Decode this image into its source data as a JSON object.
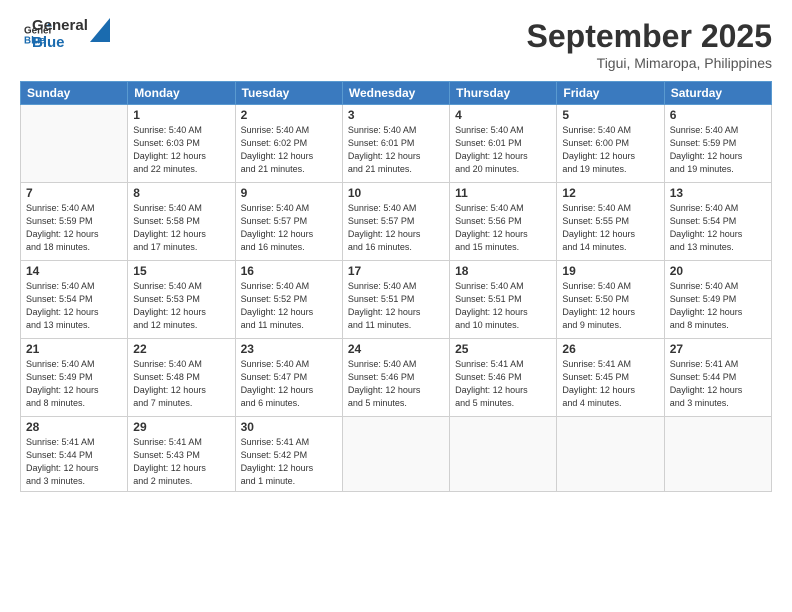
{
  "header": {
    "logo_general": "General",
    "logo_blue": "Blue",
    "month_title": "September 2025",
    "subtitle": "Tigui, Mimaropa, Philippines"
  },
  "weekdays": [
    "Sunday",
    "Monday",
    "Tuesday",
    "Wednesday",
    "Thursday",
    "Friday",
    "Saturday"
  ],
  "weeks": [
    [
      {
        "day": "",
        "info": ""
      },
      {
        "day": "1",
        "info": "Sunrise: 5:40 AM\nSunset: 6:03 PM\nDaylight: 12 hours\nand 22 minutes."
      },
      {
        "day": "2",
        "info": "Sunrise: 5:40 AM\nSunset: 6:02 PM\nDaylight: 12 hours\nand 21 minutes."
      },
      {
        "day": "3",
        "info": "Sunrise: 5:40 AM\nSunset: 6:01 PM\nDaylight: 12 hours\nand 21 minutes."
      },
      {
        "day": "4",
        "info": "Sunrise: 5:40 AM\nSunset: 6:01 PM\nDaylight: 12 hours\nand 20 minutes."
      },
      {
        "day": "5",
        "info": "Sunrise: 5:40 AM\nSunset: 6:00 PM\nDaylight: 12 hours\nand 19 minutes."
      },
      {
        "day": "6",
        "info": "Sunrise: 5:40 AM\nSunset: 5:59 PM\nDaylight: 12 hours\nand 19 minutes."
      }
    ],
    [
      {
        "day": "7",
        "info": "Sunrise: 5:40 AM\nSunset: 5:59 PM\nDaylight: 12 hours\nand 18 minutes."
      },
      {
        "day": "8",
        "info": "Sunrise: 5:40 AM\nSunset: 5:58 PM\nDaylight: 12 hours\nand 17 minutes."
      },
      {
        "day": "9",
        "info": "Sunrise: 5:40 AM\nSunset: 5:57 PM\nDaylight: 12 hours\nand 16 minutes."
      },
      {
        "day": "10",
        "info": "Sunrise: 5:40 AM\nSunset: 5:57 PM\nDaylight: 12 hours\nand 16 minutes."
      },
      {
        "day": "11",
        "info": "Sunrise: 5:40 AM\nSunset: 5:56 PM\nDaylight: 12 hours\nand 15 minutes."
      },
      {
        "day": "12",
        "info": "Sunrise: 5:40 AM\nSunset: 5:55 PM\nDaylight: 12 hours\nand 14 minutes."
      },
      {
        "day": "13",
        "info": "Sunrise: 5:40 AM\nSunset: 5:54 PM\nDaylight: 12 hours\nand 13 minutes."
      }
    ],
    [
      {
        "day": "14",
        "info": "Sunrise: 5:40 AM\nSunset: 5:54 PM\nDaylight: 12 hours\nand 13 minutes."
      },
      {
        "day": "15",
        "info": "Sunrise: 5:40 AM\nSunset: 5:53 PM\nDaylight: 12 hours\nand 12 minutes."
      },
      {
        "day": "16",
        "info": "Sunrise: 5:40 AM\nSunset: 5:52 PM\nDaylight: 12 hours\nand 11 minutes."
      },
      {
        "day": "17",
        "info": "Sunrise: 5:40 AM\nSunset: 5:51 PM\nDaylight: 12 hours\nand 11 minutes."
      },
      {
        "day": "18",
        "info": "Sunrise: 5:40 AM\nSunset: 5:51 PM\nDaylight: 12 hours\nand 10 minutes."
      },
      {
        "day": "19",
        "info": "Sunrise: 5:40 AM\nSunset: 5:50 PM\nDaylight: 12 hours\nand 9 minutes."
      },
      {
        "day": "20",
        "info": "Sunrise: 5:40 AM\nSunset: 5:49 PM\nDaylight: 12 hours\nand 8 minutes."
      }
    ],
    [
      {
        "day": "21",
        "info": "Sunrise: 5:40 AM\nSunset: 5:49 PM\nDaylight: 12 hours\nand 8 minutes."
      },
      {
        "day": "22",
        "info": "Sunrise: 5:40 AM\nSunset: 5:48 PM\nDaylight: 12 hours\nand 7 minutes."
      },
      {
        "day": "23",
        "info": "Sunrise: 5:40 AM\nSunset: 5:47 PM\nDaylight: 12 hours\nand 6 minutes."
      },
      {
        "day": "24",
        "info": "Sunrise: 5:40 AM\nSunset: 5:46 PM\nDaylight: 12 hours\nand 5 minutes."
      },
      {
        "day": "25",
        "info": "Sunrise: 5:41 AM\nSunset: 5:46 PM\nDaylight: 12 hours\nand 5 minutes."
      },
      {
        "day": "26",
        "info": "Sunrise: 5:41 AM\nSunset: 5:45 PM\nDaylight: 12 hours\nand 4 minutes."
      },
      {
        "day": "27",
        "info": "Sunrise: 5:41 AM\nSunset: 5:44 PM\nDaylight: 12 hours\nand 3 minutes."
      }
    ],
    [
      {
        "day": "28",
        "info": "Sunrise: 5:41 AM\nSunset: 5:44 PM\nDaylight: 12 hours\nand 3 minutes."
      },
      {
        "day": "29",
        "info": "Sunrise: 5:41 AM\nSunset: 5:43 PM\nDaylight: 12 hours\nand 2 minutes."
      },
      {
        "day": "30",
        "info": "Sunrise: 5:41 AM\nSunset: 5:42 PM\nDaylight: 12 hours\nand 1 minute."
      },
      {
        "day": "",
        "info": ""
      },
      {
        "day": "",
        "info": ""
      },
      {
        "day": "",
        "info": ""
      },
      {
        "day": "",
        "info": ""
      }
    ]
  ]
}
